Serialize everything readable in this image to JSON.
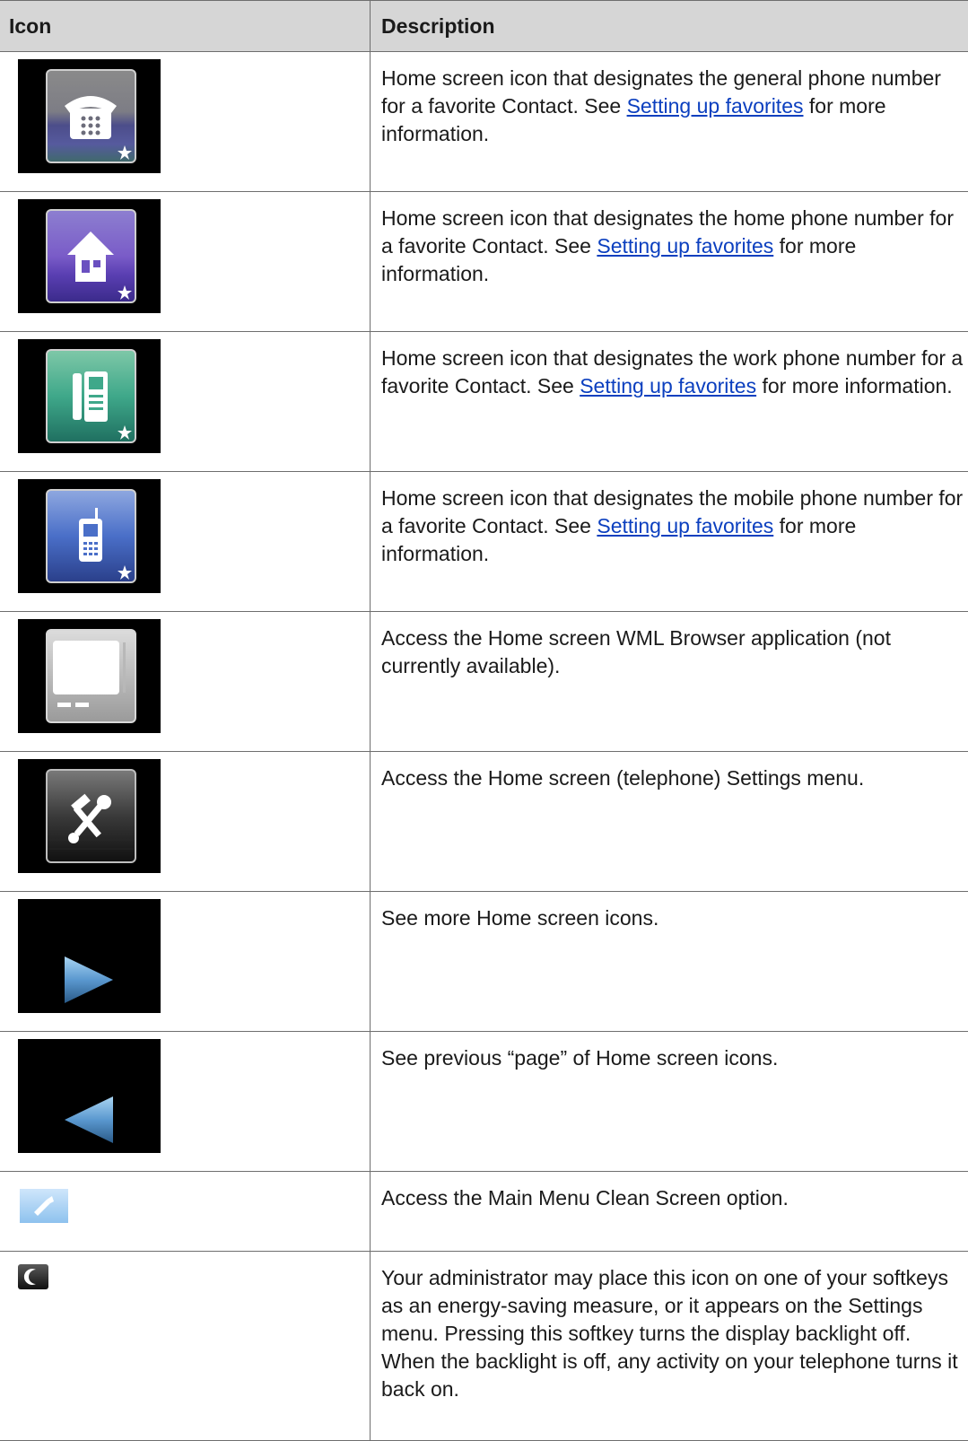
{
  "table": {
    "header_icon": "Icon",
    "header_description": "Description",
    "rows": [
      {
        "icon": "general-phone-favorite-icon",
        "text": "Home screen icon that designates the general phone number for a favorite Contact. See ",
        "link": "Setting up favorites",
        "text_after": " for more information."
      },
      {
        "icon": "home-phone-favorite-icon",
        "text": "Home screen icon that designates the home phone number for a favorite Contact. See ",
        "link": "Setting up favorites",
        "text_after": " for more information."
      },
      {
        "icon": "work-phone-favorite-icon",
        "text": "Home screen icon that designates the work phone number for a favorite Contact. See ",
        "link": "Setting up favorites",
        "text_after": " for more information."
      },
      {
        "icon": "mobile-phone-favorite-icon",
        "text": "Home screen icon that designates the mobile phone number for a favorite Contact. See ",
        "link": "Setting up favorites",
        "text_after": " for more information."
      },
      {
        "icon": "wml-browser-icon",
        "text": "Access the Home screen WML Browser application (not currently available)."
      },
      {
        "icon": "settings-tools-icon",
        "text": "Access the Home screen (telephone) Settings menu."
      },
      {
        "icon": "next-page-arrow-icon",
        "text": "See more Home screen icons."
      },
      {
        "icon": "previous-page-arrow-icon",
        "text": "See previous “page” of Home screen icons."
      },
      {
        "icon": "clean-screen-icon",
        "text": "Access the Main Menu Clean Screen option."
      },
      {
        "icon": "backlight-off-moon-icon",
        "text": "Your administrator may place this icon on one of your softkeys as an energy-saving measure, or it appears on the Settings menu. Pressing this softkey turns the display backlight off. When the backlight is off, any activity on your telephone turns it back on."
      }
    ]
  }
}
